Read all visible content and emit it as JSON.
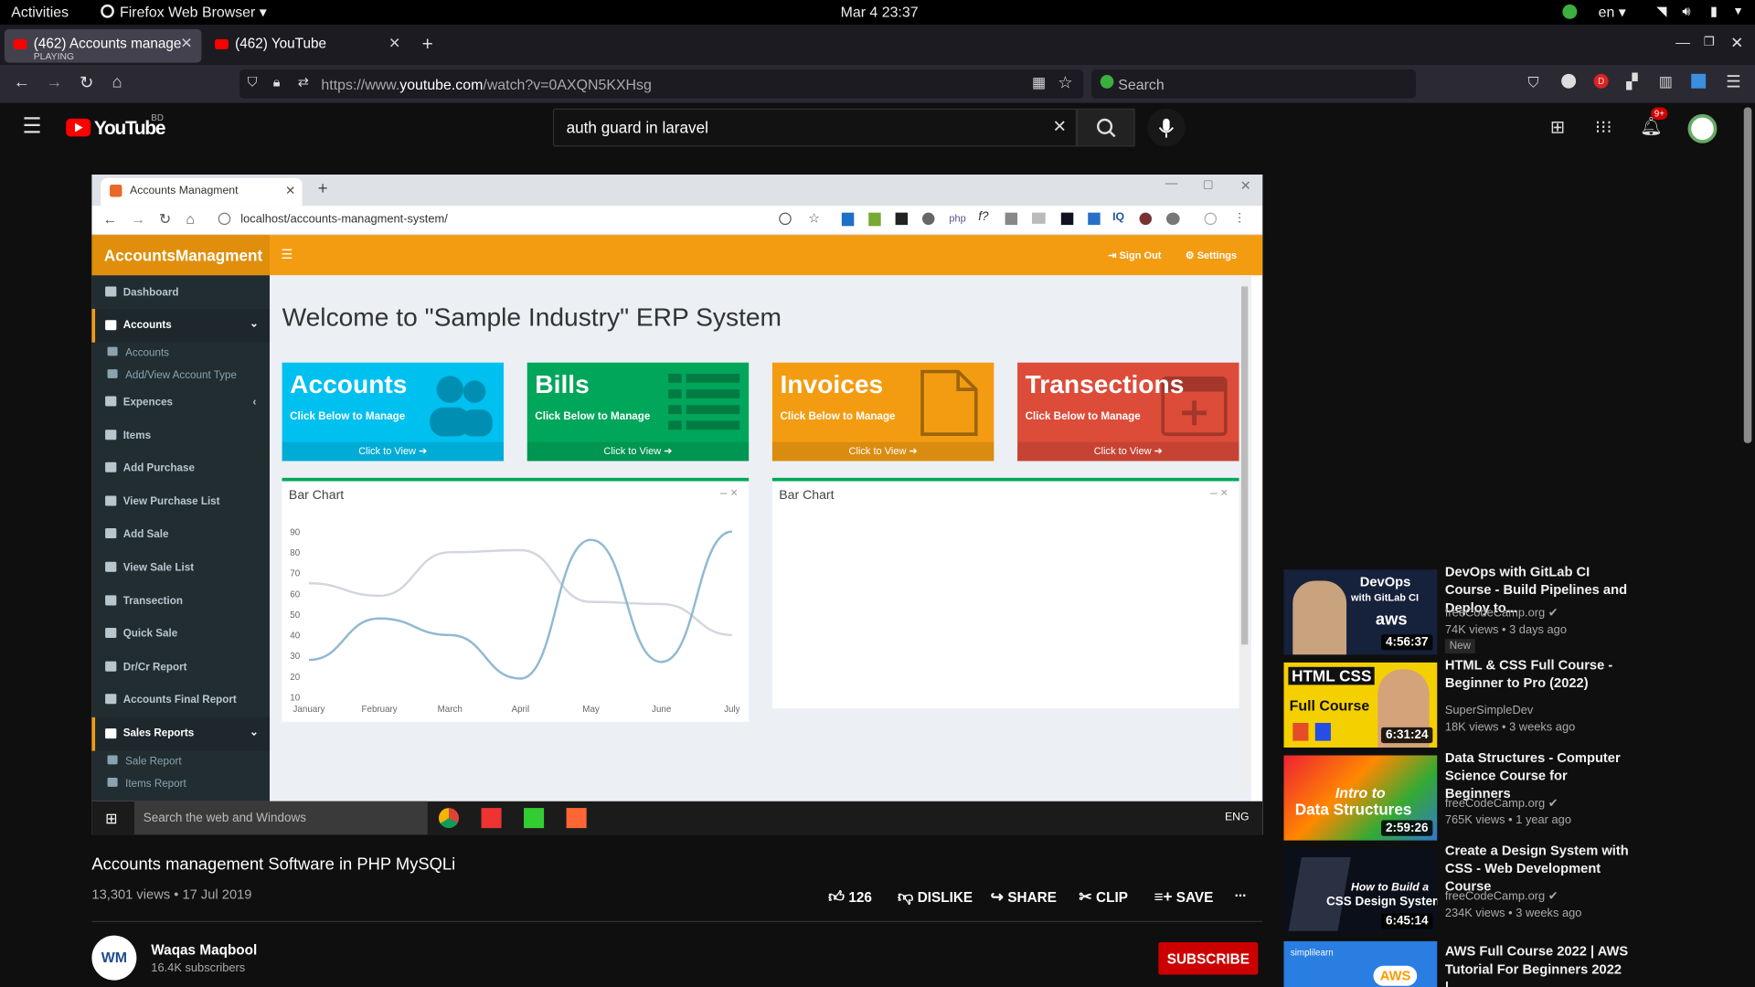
{
  "topbar": {
    "activities": "Activities",
    "app": "Firefox Web Browser ▾",
    "datetime": "Mar 4  23:37",
    "lang": "en ▾"
  },
  "firefox": {
    "tabs": [
      {
        "title": "(462) Accounts managem",
        "sub": "PLAYING"
      },
      {
        "title": "(462) YouTube"
      }
    ],
    "url_prefix": "https://www.",
    "url_domain": "youtube.com",
    "url_rest": "/watch?v=0AXQN5KXHsg",
    "search_placeholder": "Search"
  },
  "youtube": {
    "logo": "YouTube",
    "region": "BD",
    "search_value": "auth guard in laravel",
    "notif_count": "9+",
    "video": {
      "title": "Accounts management Software in PHP MySQLi",
      "meta": "13,301 views • 17 Jul 2019",
      "likes": "126",
      "dislike": "DISLIKE",
      "share": "SHARE",
      "clip": "CLIP",
      "save": "SAVE",
      "more": "..."
    },
    "channel": {
      "name": "Waqas Maqbool",
      "subs": "16.4K subscribers",
      "subscribe": "SUBSCRIBE",
      "avatar": "WM"
    },
    "recommendations": [
      {
        "title": "DevOps with GitLab CI Course - Build Pipelines and Deploy to...",
        "channel": "freeCodeCamp.org",
        "meta": "74K views • 3 days ago",
        "badge": "New",
        "duration": "4:56:37",
        "thumb": {
          "l1": "DevOps",
          "l2": "with GitLab CI",
          "l3": "aws"
        }
      },
      {
        "title": "HTML & CSS Full Course - Beginner to Pro (2022)",
        "channel": "SuperSimpleDev",
        "meta": "18K views • 3 weeks ago",
        "duration": "6:31:24",
        "thumb": {
          "l1": "HTML CSS",
          "l2": "Full Course"
        }
      },
      {
        "title": "Data Structures - Computer Science Course for Beginners",
        "channel": "freeCodeCamp.org",
        "meta": "765K views • 1 year ago",
        "duration": "2:59:26",
        "thumb": {
          "l1": "Intro to",
          "l2": "Data Structures"
        }
      },
      {
        "title": "Create a Design System with CSS - Web Development Course",
        "channel": "freeCodeCamp.org",
        "meta": "234K views • 3 weeks ago",
        "duration": "6:45:14",
        "thumb": {
          "l1": "How to Build a",
          "l2": "CSS Design System"
        }
      },
      {
        "title": "AWS Full Course 2022 | AWS Tutorial For Beginners 2022 |...",
        "thumb": {
          "l1": "simplilearn",
          "l2": "AWS"
        }
      }
    ]
  },
  "inner": {
    "chrome_tab": "Accounts Managment",
    "chrome_url": "localhost/accounts-managment-system/",
    "brand": "AccountsManagment",
    "signout": "Sign Out",
    "settings": "Settings",
    "heading": "Welcome to \"Sample Industry\" ERP System",
    "sidebar": [
      "Dashboard",
      "Accounts",
      "Accounts",
      "Add/View Account Type",
      "Expences",
      "Items",
      "Add Purchase",
      "View Purchase List",
      "Add Sale",
      "View Sale List",
      "Transection",
      "Quick Sale",
      "Dr/Cr Report",
      "Accounts Final Report",
      "Sales Reports",
      "Sale Report",
      "Items Report"
    ],
    "boxes": [
      {
        "title": "Accounts",
        "sub": "Click Below to Manage",
        "link": "Click to View ➔",
        "color": "#00c0ef"
      },
      {
        "title": "Bills",
        "sub": "Click Below to Manage",
        "link": "Click to View ➔",
        "color": "#00a65a"
      },
      {
        "title": "Invoices",
        "sub": "Click Below to Manage",
        "link": "Click to View ➔",
        "color": "#f39c12"
      },
      {
        "title": "Transections",
        "sub": "Click Below to Manage",
        "link": "Click to View ➔",
        "color": "#dd4b39"
      }
    ],
    "panel_title": "Bar Chart",
    "panel_controls": "–  ×",
    "taskbar_search": "Search the web and Windows",
    "taskbar_lang": "ENG"
  },
  "chart_data": [
    {
      "type": "line",
      "title": "Bar Chart",
      "categories": [
        "January",
        "February",
        "March",
        "April",
        "May",
        "June",
        "July"
      ],
      "ylim": [
        10,
        90
      ],
      "yticks": [
        10,
        20,
        30,
        40,
        50,
        60,
        70,
        80,
        90
      ],
      "series": [
        {
          "values": [
            65,
            59,
            80,
            81,
            56,
            55,
            40
          ],
          "color": "#d2d6de"
        },
        {
          "values": [
            28,
            48,
            40,
            19,
            86,
            27,
            90
          ],
          "color": "#8fb9d4"
        }
      ]
    },
    {
      "type": "line",
      "title": "Bar Chart",
      "categories": [],
      "series": []
    }
  ]
}
